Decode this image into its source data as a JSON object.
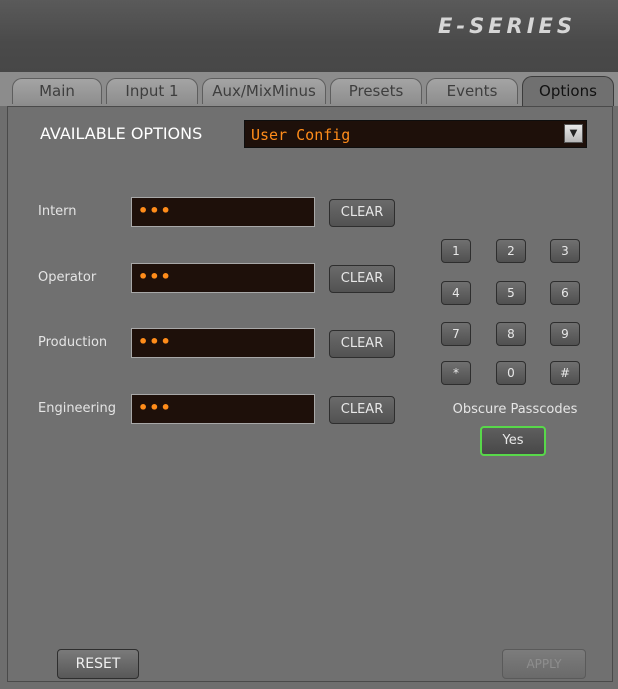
{
  "header": {
    "brand": "E-SERIES"
  },
  "tabs": [
    {
      "label": "Main"
    },
    {
      "label": "Input 1"
    },
    {
      "label": "Aux/MixMinus"
    },
    {
      "label": "Presets"
    },
    {
      "label": "Events"
    },
    {
      "label": "Options",
      "active": true
    }
  ],
  "options": {
    "available_label": "AVAILABLE OPTIONS",
    "selected": "User Config"
  },
  "users": [
    {
      "label": "Intern",
      "value": "•••",
      "clear": "CLEAR"
    },
    {
      "label": "Operator",
      "value": "•••",
      "clear": "CLEAR"
    },
    {
      "label": "Production",
      "value": "•••",
      "clear": "CLEAR"
    },
    {
      "label": "Engineering",
      "value": "•••",
      "clear": "CLEAR"
    }
  ],
  "keypad": [
    "1",
    "2",
    "3",
    "4",
    "5",
    "6",
    "7",
    "8",
    "9",
    "*",
    "0",
    "#"
  ],
  "obscure": {
    "label": "Obscure Passcodes",
    "value": "Yes"
  },
  "footer": {
    "reset": "RESET",
    "apply": "APPLY"
  },
  "colors": {
    "readout": "#ff8c1a",
    "toggle_on_border": "#58d84a",
    "field_bg": "#1e100a"
  }
}
